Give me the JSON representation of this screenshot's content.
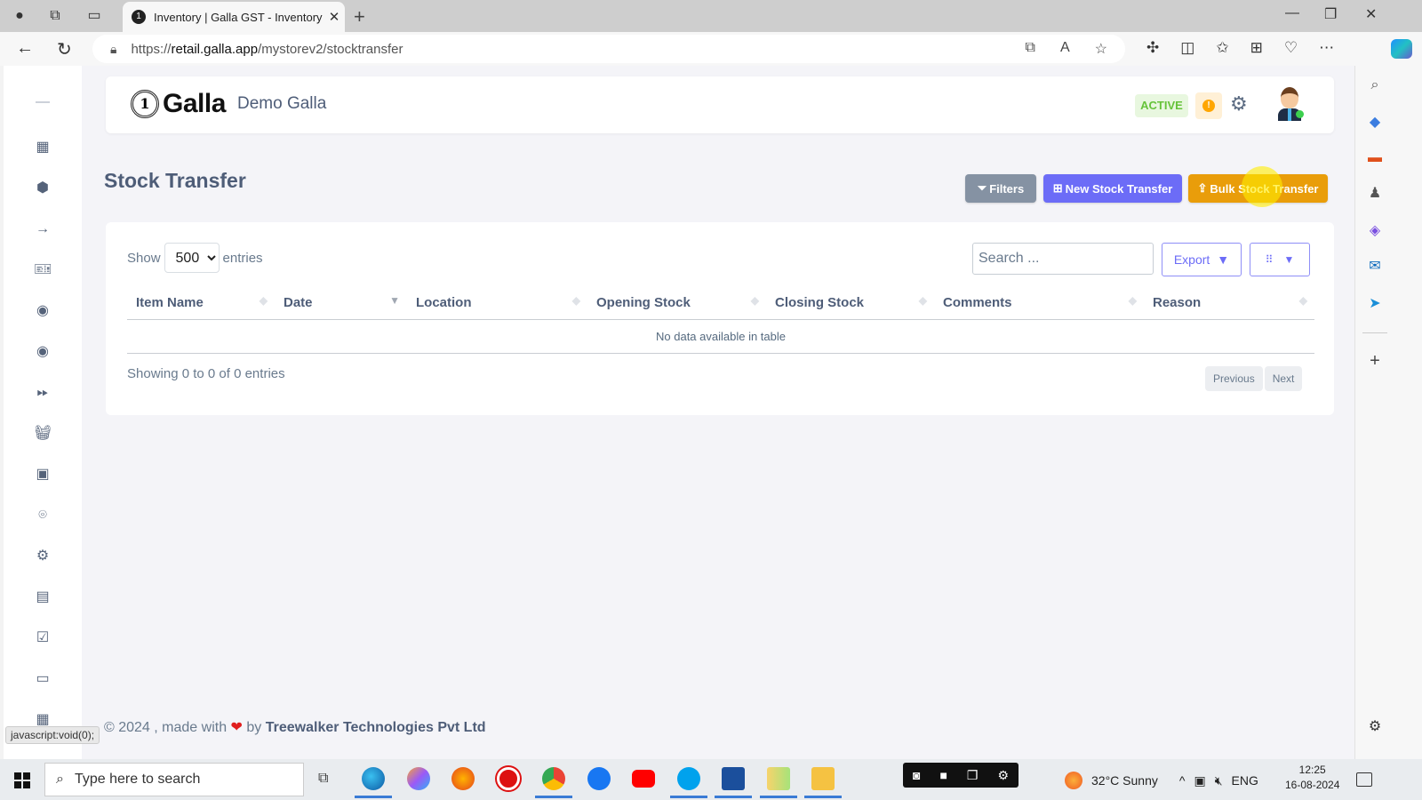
{
  "browser": {
    "tab_title": "Inventory | Galla GST - Inventory",
    "url_prefix": "https://",
    "url_domain": "retail.galla.app",
    "url_path": "/mystorev2/stocktransfer",
    "status_bar_text": "javascript:void(0);"
  },
  "header": {
    "brand": "Galla",
    "store_name": "Demo Galla",
    "status_badge": "ACTIVE",
    "alert_symbol": "!"
  },
  "page": {
    "title": "Stock Transfer",
    "buttons": {
      "filters": "Filters",
      "new_transfer": "New Stock Transfer",
      "bulk_transfer": "Bulk Stock Transfer"
    }
  },
  "table": {
    "show_label": "Show",
    "entries_label": "entries",
    "page_size": "500",
    "search_placeholder": "Search ...",
    "export_label": "Export",
    "columns": [
      "Item Name",
      "Date",
      "Location",
      "Opening Stock",
      "Closing Stock",
      "Comments",
      "Reason"
    ],
    "empty_message": "No data available in table",
    "info": "Showing 0 to 0 of 0 entries",
    "previous": "Previous",
    "next": "Next"
  },
  "sidebar": {
    "items": [
      {
        "icon": "dashboard-icon"
      },
      {
        "icon": "box-icon"
      },
      {
        "icon": "arrow-right-icon"
      },
      {
        "icon": "discount-ticket-icon"
      },
      {
        "icon": "user-circle-icon"
      },
      {
        "icon": "user-circle-icon"
      },
      {
        "icon": "fast-forward-icon"
      },
      {
        "icon": "basket-icon"
      },
      {
        "icon": "contacts-icon"
      },
      {
        "icon": "location-pin-icon"
      },
      {
        "icon": "settings-icon"
      },
      {
        "icon": "report-icon"
      },
      {
        "icon": "checkbox-icon"
      },
      {
        "icon": "cash-icon"
      },
      {
        "icon": "calendar-icon"
      }
    ]
  },
  "footer": {
    "prefix": "© 2024 , made with",
    "heart": "❤",
    "by": "by",
    "company": "Treewalker Technologies Pvt Ltd"
  },
  "taskbar": {
    "search_placeholder": "Type here to search",
    "weather": "32°C  Sunny",
    "language": "ENG",
    "time": "12:25",
    "date": "16-08-2024"
  },
  "colors": {
    "primary": "#6c6cf7",
    "warning": "#e99d0a",
    "secondary": "#8592a3",
    "success_text": "#66c33a",
    "text_heading": "#4e5d78"
  }
}
